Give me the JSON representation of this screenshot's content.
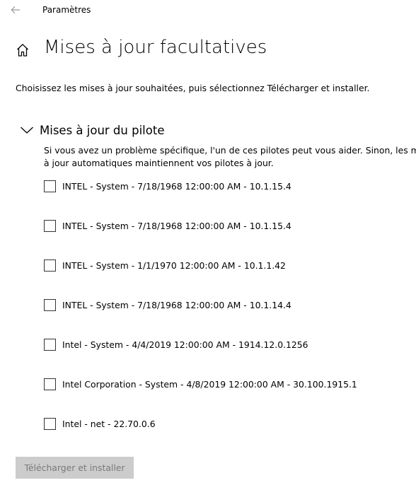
{
  "window": {
    "app_title": "Paramètres",
    "back_icon": "arrow-left-icon"
  },
  "header": {
    "home_icon": "home-icon",
    "title": "Mises à jour facultatives"
  },
  "intro_text": "Choisissez les mises à jour souhaitées, puis sélectionnez Télécharger et installer.",
  "driver_section": {
    "expand_icon": "chevron-down-icon",
    "title": "Mises à jour du pilote",
    "description": "Si vous avez un problème spécifique, l'un de ces pilotes peut vous aider. Sinon, les mises à jour automatiques maintiennent vos pilotes à jour.",
    "items": [
      {
        "label": "INTEL - System - 7/18/1968 12:00:00 AM - 10.1.15.4",
        "checked": false
      },
      {
        "label": "INTEL - System - 7/18/1968 12:00:00 AM - 10.1.15.4",
        "checked": false
      },
      {
        "label": "INTEL - System - 1/1/1970 12:00:00 AM - 10.1.1.42",
        "checked": false
      },
      {
        "label": "INTEL - System - 7/18/1968 12:00:00 AM - 10.1.14.4",
        "checked": false
      },
      {
        "label": "Intel - System - 4/4/2019 12:00:00 AM - 1914.12.0.1256",
        "checked": false
      },
      {
        "label": "Intel Corporation - System - 4/8/2019 12:00:00 AM - 30.100.1915.1",
        "checked": false
      },
      {
        "label": "Intel - net - 22.70.0.6",
        "checked": false
      }
    ]
  },
  "actions": {
    "download_label": "Télécharger et installer",
    "download_enabled": false
  }
}
